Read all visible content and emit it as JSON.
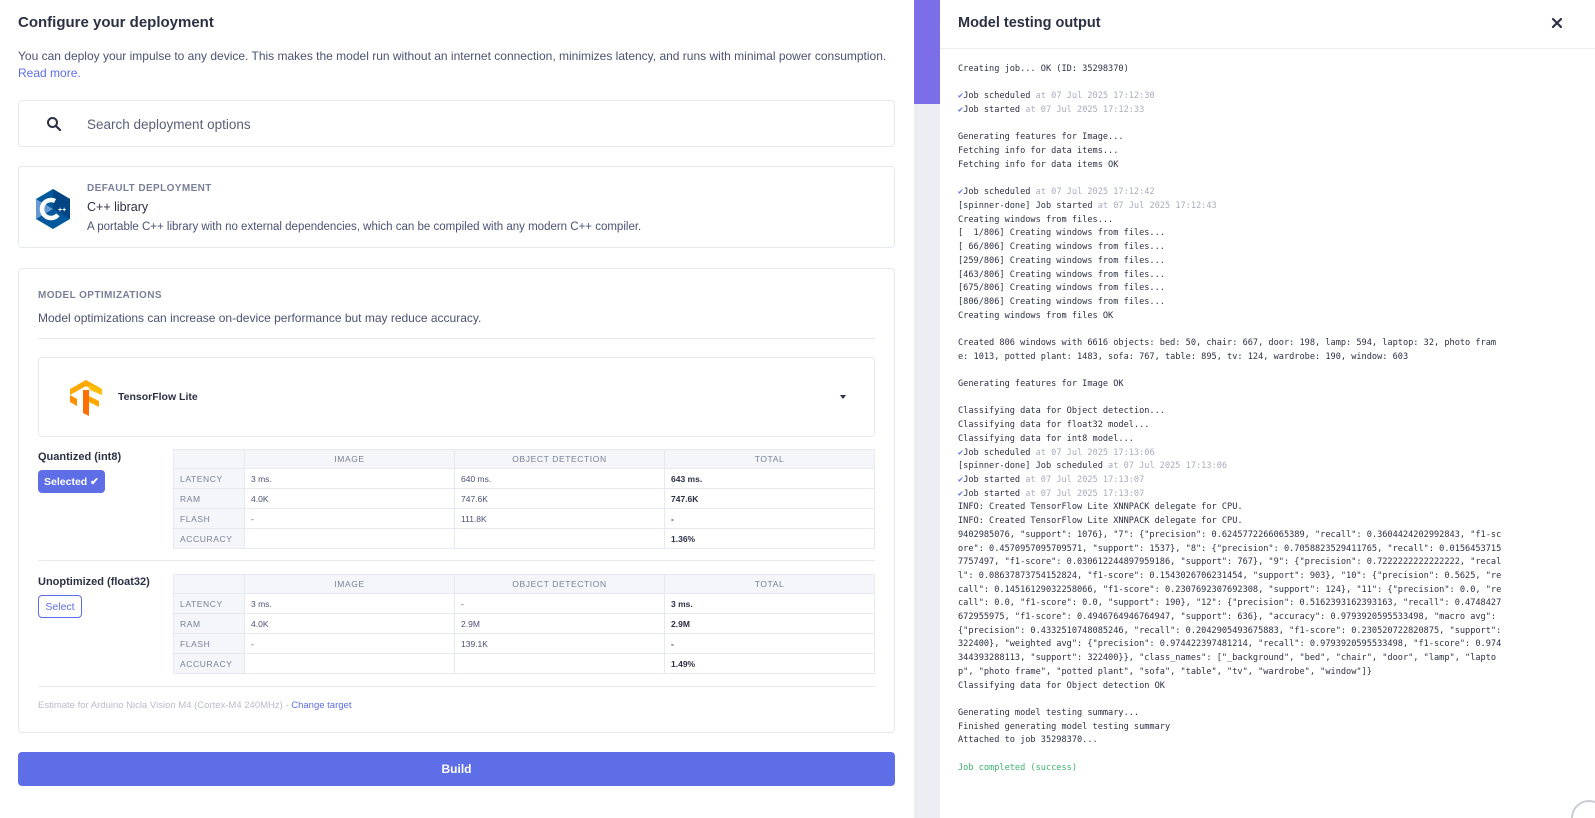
{
  "left": {
    "title": "Configure your deployment",
    "intro_text": "You can deploy your impulse to any device. This makes the model run without an internet connection, minimizes latency, and runs with minimal power consumption. ",
    "intro_link": "Read more.",
    "search": {
      "placeholder": "Search deployment options"
    },
    "default_deployment": {
      "label": "DEFAULT DEPLOYMENT",
      "title": "C++ library",
      "description": "A portable C++ library with no external dependencies, which can be compiled with any modern C++ compiler."
    },
    "optimizations": {
      "label": "MODEL OPTIMIZATIONS",
      "description": "Model optimizations can increase on-device performance but may reduce accuracy.",
      "engine": "TensorFlow Lite",
      "columns": [
        "IMAGE",
        "OBJECT DETECTION",
        "TOTAL"
      ],
      "variants": [
        {
          "name": "Quantized (int8)",
          "button": "Selected",
          "rows": [
            {
              "label": "LATENCY",
              "image": "3 ms.",
              "od": "640 ms.",
              "total": "643 ms."
            },
            {
              "label": "RAM",
              "image": "4.0K",
              "od": "747.6K",
              "total": "747.6K"
            },
            {
              "label": "FLASH",
              "image": "-",
              "od": "111.8K",
              "total": "-"
            },
            {
              "label": "ACCURACY",
              "image": "",
              "od": "",
              "total": "1.36%"
            }
          ]
        },
        {
          "name": "Unoptimized (float32)",
          "button": "Select",
          "rows": [
            {
              "label": "LATENCY",
              "image": "3 ms.",
              "od": "-",
              "total": "3 ms."
            },
            {
              "label": "RAM",
              "image": "4.0K",
              "od": "2.9M",
              "total": "2.9M"
            },
            {
              "label": "FLASH",
              "image": "-",
              "od": "139.1K",
              "total": "-"
            },
            {
              "label": "ACCURACY",
              "image": "",
              "od": "",
              "total": "1.49%"
            }
          ]
        }
      ],
      "estimate_text": "Estimate for Arduino Nicla Vision M4 (Cortex-M4 240MHz) - ",
      "change_target": "Change target"
    },
    "build_label": "Build"
  },
  "right": {
    "title": "Model testing output",
    "log": [
      {
        "text": "Creating job... OK (ID: 35298370)"
      },
      {
        "text": ""
      },
      {
        "check": true,
        "text": "Job scheduled",
        "ts": " at 07 Jul 2025 17:12:30"
      },
      {
        "check": true,
        "text": "Job started",
        "ts": " at 07 Jul 2025 17:12:33"
      },
      {
        "text": ""
      },
      {
        "text": "Generating features for Image..."
      },
      {
        "text": "Fetching info for data items..."
      },
      {
        "text": "Fetching info for data items OK"
      },
      {
        "text": ""
      },
      {
        "check": true,
        "text": "Job scheduled",
        "ts": " at 07 Jul 2025 17:12:42"
      },
      {
        "text": "[spinner-done] Job started",
        "ts": " at 07 Jul 2025 17:12:43"
      },
      {
        "text": "Creating windows from files..."
      },
      {
        "text": "[  1/806] Creating windows from files..."
      },
      {
        "text": "[ 66/806] Creating windows from files..."
      },
      {
        "text": "[259/806] Creating windows from files..."
      },
      {
        "text": "[463/806] Creating windows from files..."
      },
      {
        "text": "[675/806] Creating windows from files..."
      },
      {
        "text": "[806/806] Creating windows from files..."
      },
      {
        "text": "Creating windows from files OK"
      },
      {
        "text": ""
      },
      {
        "text": "Created 806 windows with 6616 objects: bed: 50, chair: 667, door: 198, lamp: 594, laptop: 32, photo frame: 1013, potted plant: 1483, sofa: 767, table: 895, tv: 124, wardrobe: 190, window: 603"
      },
      {
        "text": ""
      },
      {
        "text": "Generating features for Image OK"
      },
      {
        "text": ""
      },
      {
        "text": "Classifying data for Object detection..."
      },
      {
        "text": "Classifying data for float32 model..."
      },
      {
        "text": "Classifying data for int8 model..."
      },
      {
        "check": true,
        "text": "Job scheduled",
        "ts": " at 07 Jul 2025 17:13:06"
      },
      {
        "text": "[spinner-done] Job scheduled",
        "ts": " at 07 Jul 2025 17:13:06"
      },
      {
        "check": true,
        "text": "Job started",
        "ts": " at 07 Jul 2025 17:13:07"
      },
      {
        "check": true,
        "text": "Job started",
        "ts": " at 07 Jul 2025 17:13:07"
      },
      {
        "text": "INFO: Created TensorFlow Lite XNNPACK delegate for CPU."
      },
      {
        "text": "INFO: Created TensorFlow Lite XNNPACK delegate for CPU."
      },
      {
        "text": "9402985076, \"support\": 1076}, \"7\": {\"precision\": 0.6245772266065389, \"recall\": 0.3604424202992843, \"f1-score\": 0.4570957095709571, \"support\": 1537}, \"8\": {\"precision\": 0.7058823529411765, \"recall\": 0.01564537157757497, \"f1-score\": 0.030612244897959186, \"support\": 767}, \"9\": {\"precision\": 0.7222222222222222, \"recall\": 0.08637873754152824, \"f1-score\": 0.1543026706231454, \"support\": 903}, \"10\": {\"precision\": 0.5625, \"recall\": 0.14516129032258066, \"f1-score\": 0.2307692307692308, \"support\": 124}, \"11\": {\"precision\": 0.0, \"recall\": 0.0, \"f1-score\": 0.0, \"support\": 190}, \"12\": {\"precision\": 0.5162393162393163, \"recall\": 0.4748427672955975, \"f1-score\": 0.4946764946764947, \"support\": 636}, \"accuracy\": 0.9793920595533498, \"macro avg\": {\"precision\": 0.4332510748085246, \"recall\": 0.2042905493675883, \"f1-score\": 0.230520722820875, \"support\": 322400}, \"weighted avg\": {\"precision\": 0.974422397481214, \"recall\": 0.9793920595533498, \"f1-score\": 0.974344393288113, \"support\": 322400}}, \"class_names\": [\"_background\", \"bed\", \"chair\", \"door\", \"lamp\", \"laptop\", \"photo frame\", \"potted plant\", \"sofa\", \"table\", \"tv\", \"wardrobe\", \"window\"]}"
      },
      {
        "text": "Classifying data for Object detection OK"
      },
      {
        "text": ""
      },
      {
        "text": "Generating model testing summary..."
      },
      {
        "text": "Finished generating model testing summary"
      },
      {
        "text": "Attached to job 35298370..."
      },
      {
        "text": ""
      },
      {
        "ok": true,
        "text": "Job completed (success)"
      }
    ]
  }
}
